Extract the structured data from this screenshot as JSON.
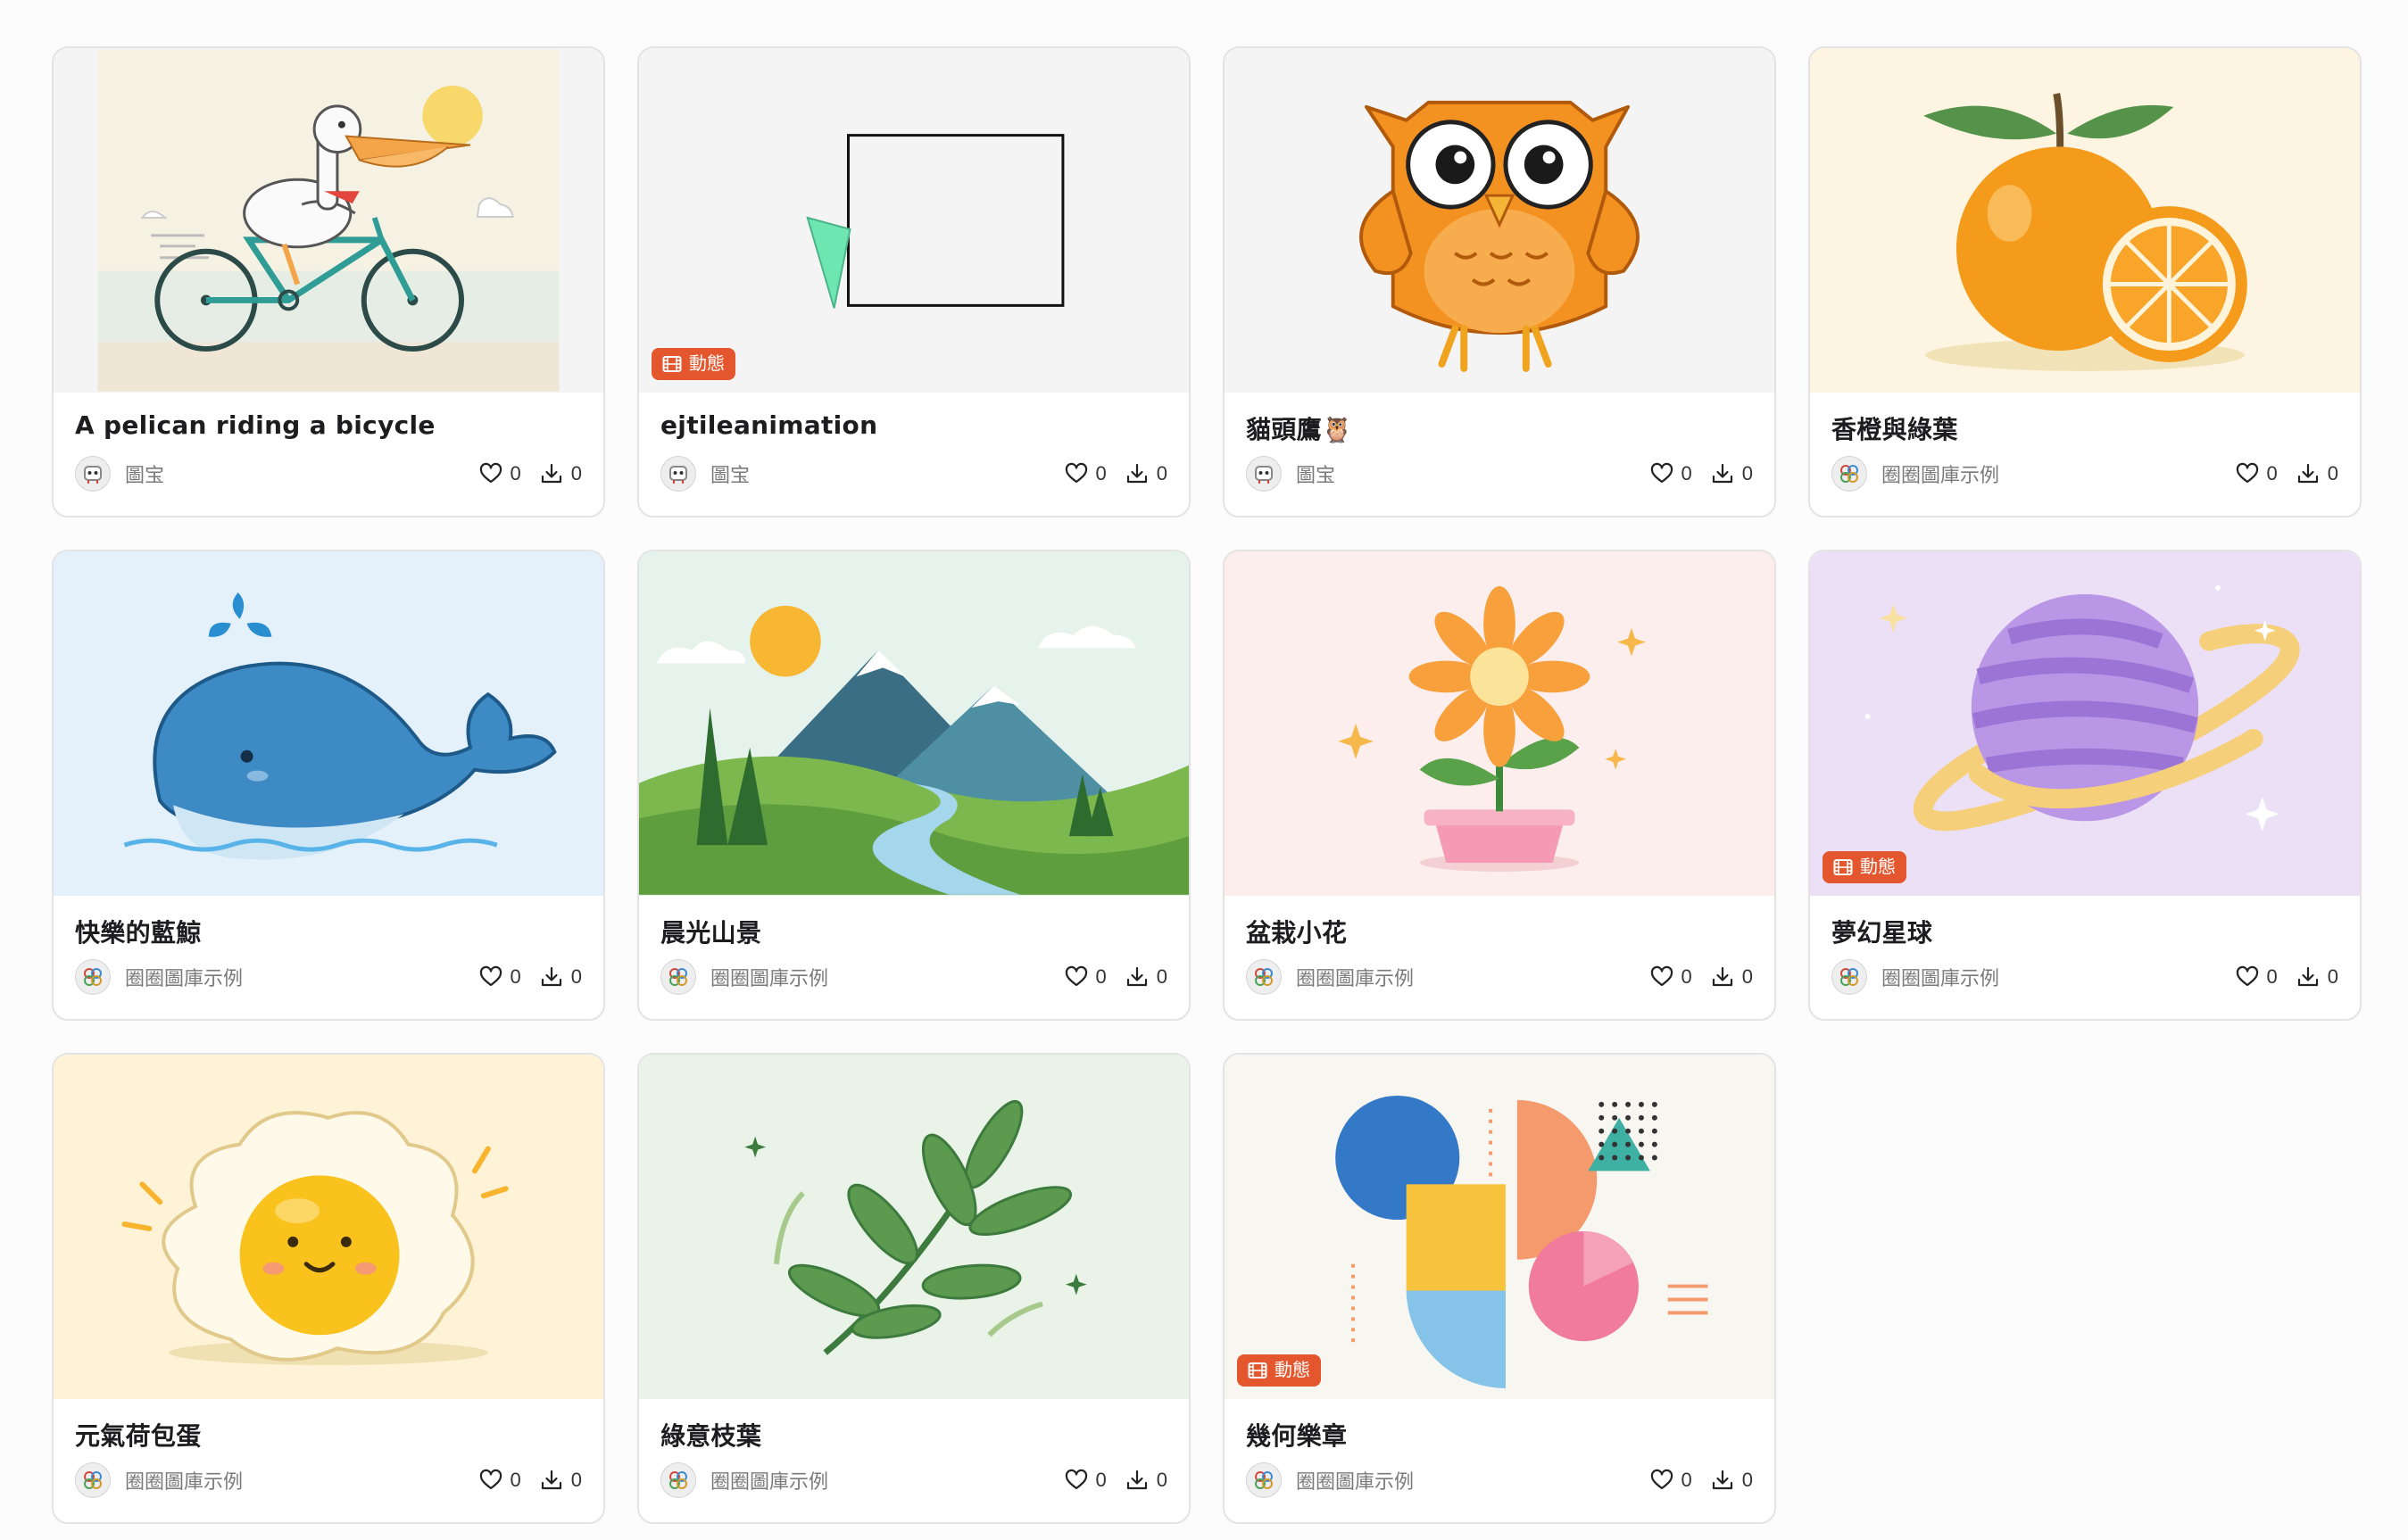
{
  "badge_label": "動態",
  "cards": [
    {
      "title": "A pelican riding a bicycle",
      "author": "圖宝",
      "likes": "0",
      "downloads": "0",
      "animated": false
    },
    {
      "title": "ejtileanimation",
      "author": "圖宝",
      "likes": "0",
      "downloads": "0",
      "animated": true
    },
    {
      "title": "貓頭鷹🦉",
      "author": "圖宝",
      "likes": "0",
      "downloads": "0",
      "animated": false
    },
    {
      "title": "香橙與綠葉",
      "author": "圈圈圖庫示例",
      "likes": "0",
      "downloads": "0",
      "animated": false
    },
    {
      "title": "快樂的藍鯨",
      "author": "圈圈圖庫示例",
      "likes": "0",
      "downloads": "0",
      "animated": false
    },
    {
      "title": "晨光山景",
      "author": "圈圈圖庫示例",
      "likes": "0",
      "downloads": "0",
      "animated": false
    },
    {
      "title": "盆栽小花",
      "author": "圈圈圖庫示例",
      "likes": "0",
      "downloads": "0",
      "animated": false
    },
    {
      "title": "夢幻星球",
      "author": "圈圈圖庫示例",
      "likes": "0",
      "downloads": "0",
      "animated": true
    },
    {
      "title": "元氣荷包蛋",
      "author": "圈圈圖庫示例",
      "likes": "0",
      "downloads": "0",
      "animated": false
    },
    {
      "title": "綠意枝葉",
      "author": "圈圈圖庫示例",
      "likes": "0",
      "downloads": "0",
      "animated": false
    },
    {
      "title": "幾何樂章",
      "author": "圈圈圖庫示例",
      "likes": "0",
      "downloads": "0",
      "animated": true
    }
  ],
  "icons": {
    "like": "heart-icon",
    "download": "download-icon",
    "badge": "film-icon"
  },
  "colors": {
    "badge_bg": "#e4572e",
    "card_border": "#e3e3e3"
  }
}
